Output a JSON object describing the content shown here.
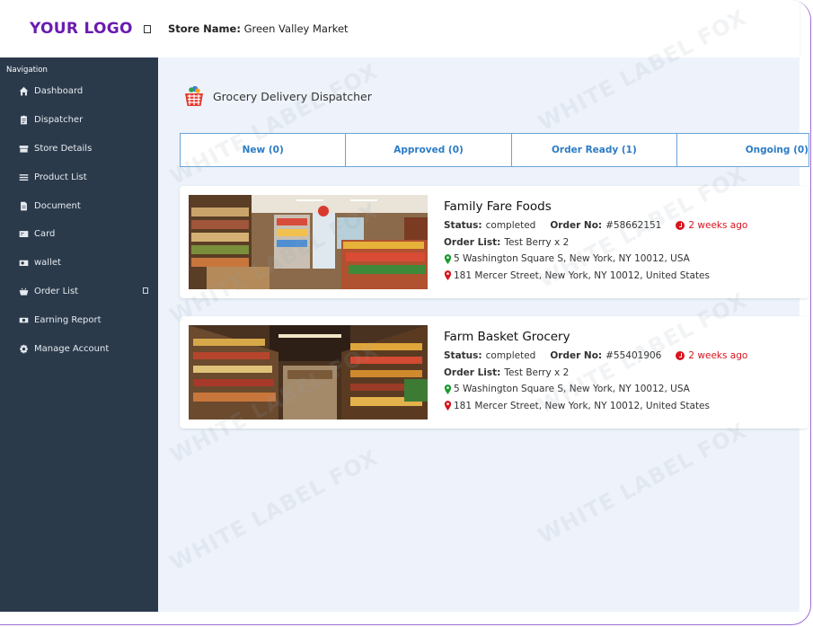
{
  "header": {
    "logo": "YOUR LOGO",
    "store_label": "Store Name:",
    "store_value": "Green Valley Market"
  },
  "sidebar": {
    "title": "Navigation",
    "items": [
      {
        "label": "Dashboard",
        "icon": "home-icon"
      },
      {
        "label": "Dispatcher",
        "icon": "clipboard-icon"
      },
      {
        "label": "Store Details",
        "icon": "store-icon"
      },
      {
        "label": "Product List",
        "icon": "list-icon"
      },
      {
        "label": "Document",
        "icon": "document-icon"
      },
      {
        "label": "Card",
        "icon": "card-icon"
      },
      {
        "label": "wallet",
        "icon": "wallet-icon"
      },
      {
        "label": "Order List",
        "icon": "basket-icon"
      },
      {
        "label": "Earning Report",
        "icon": "money-icon"
      },
      {
        "label": "Manage Account",
        "icon": "gear-icon"
      }
    ]
  },
  "page": {
    "title": "Grocery Delivery Dispatcher"
  },
  "tabs": [
    {
      "label": "New (0)"
    },
    {
      "label": "Approved (0)"
    },
    {
      "label": "Order Ready (1)"
    },
    {
      "label": "Ongoing (0)"
    }
  ],
  "orders": [
    {
      "shop": "Family Fare Foods",
      "status_label": "Status:",
      "status": "completed",
      "order_no_label": "Order No:",
      "order_no": "#58662151",
      "ago": "2 weeks ago",
      "list_label": "Order List:",
      "list": "Test Berry x 2",
      "pickup": "5 Washington Square S, New York, NY 10012, USA",
      "dropoff": "181 Mercer Street, New York, NY 10012, United States"
    },
    {
      "shop": "Farm Basket Grocery",
      "status_label": "Status:",
      "status": "completed",
      "order_no_label": "Order No:",
      "order_no": "#55401906",
      "ago": "2 weeks ago",
      "list_label": "Order List:",
      "list": "Test Berry x 2",
      "pickup": "5 Washington Square S, New York, NY 10012, USA",
      "dropoff": "181 Mercer Street, New York, NY 10012, United States"
    }
  ],
  "watermark": "WHITE LABEL FOX",
  "colors": {
    "logo": "#6a1cb0",
    "sidebar": "#2b3a4b",
    "tab_text": "#2b7bc5",
    "time_red": "#d8131f",
    "pickup_pin": "#1a9a2c",
    "drop_pin": "#d8131f"
  }
}
